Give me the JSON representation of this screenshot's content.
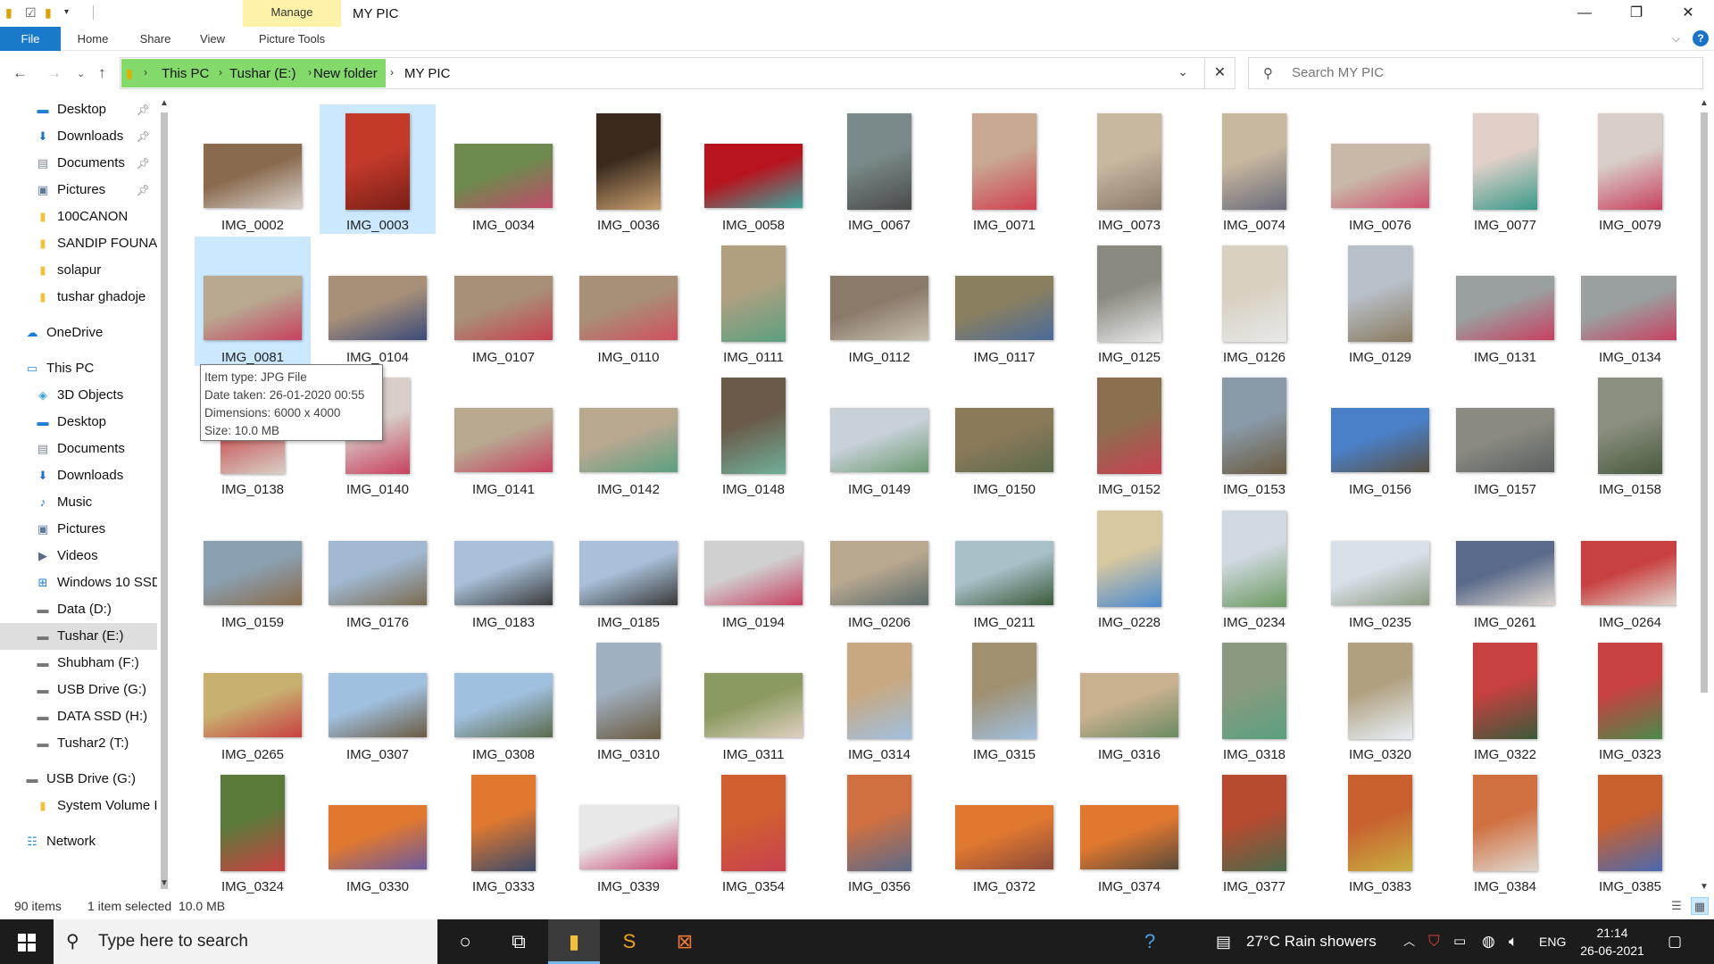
{
  "window": {
    "title": "MY PIC",
    "manage_tab": "Manage",
    "picture_tools_tab": "Picture Tools",
    "minimize": "—",
    "restore": "❐",
    "close": "✕"
  },
  "ribbon": {
    "tabs": [
      "File",
      "Home",
      "Share",
      "View"
    ]
  },
  "address": {
    "crumbs": [
      "This PC",
      "Tushar (E:)",
      "New folder",
      "MY PIC"
    ],
    "search_placeholder": "Search MY PIC"
  },
  "navpane": {
    "items": [
      {
        "label": "Desktop",
        "icon": "desktop-icon",
        "glyph": "▬",
        "color": "#1e7fd6",
        "pinned": true,
        "indent": 1
      },
      {
        "label": "Downloads",
        "icon": "download-icon",
        "glyph": "⬇",
        "color": "#1e6fc6",
        "pinned": true,
        "indent": 1
      },
      {
        "label": "Documents",
        "icon": "documents-icon",
        "glyph": "▤",
        "color": "#7a8a9a",
        "pinned": true,
        "indent": 1
      },
      {
        "label": "Pictures",
        "icon": "pictures-icon",
        "glyph": "▣",
        "color": "#5a7a9a",
        "pinned": true,
        "indent": 1
      },
      {
        "label": "100CANON",
        "icon": "folder-icon",
        "glyph": "▮",
        "color": "#f2c13c",
        "pinned": false,
        "indent": 1
      },
      {
        "label": "SANDIP FOUNAI",
        "icon": "folder-icon",
        "glyph": "▮",
        "color": "#f2c13c",
        "pinned": false,
        "indent": 1
      },
      {
        "label": "solapur",
        "icon": "folder-icon",
        "glyph": "▮",
        "color": "#f2c13c",
        "pinned": false,
        "indent": 1
      },
      {
        "label": "tushar ghadoje",
        "icon": "folder-icon",
        "glyph": "▮",
        "color": "#f2c13c",
        "pinned": false,
        "indent": 1
      },
      {
        "label": "OneDrive",
        "icon": "cloud-icon",
        "glyph": "☁",
        "color": "#1a7bd3",
        "pinned": false,
        "indent": 0,
        "gap": true
      },
      {
        "label": "This PC",
        "icon": "computer-icon",
        "glyph": "▭",
        "color": "#2a8ad8",
        "pinned": false,
        "indent": 0,
        "gap": true
      },
      {
        "label": "3D Objects",
        "icon": "cube-icon",
        "glyph": "◈",
        "color": "#3aa0e0",
        "pinned": false,
        "indent": 1
      },
      {
        "label": "Desktop",
        "icon": "desktop-icon",
        "glyph": "▬",
        "color": "#1e7fd6",
        "pinned": false,
        "indent": 1
      },
      {
        "label": "Documents",
        "icon": "documents-icon",
        "glyph": "▤",
        "color": "#7a8a9a",
        "pinned": false,
        "indent": 1
      },
      {
        "label": "Downloads",
        "icon": "download-icon",
        "glyph": "⬇",
        "color": "#1e6fc6",
        "pinned": false,
        "indent": 1
      },
      {
        "label": "Music",
        "icon": "music-icon",
        "glyph": "♪",
        "color": "#1e6fc6",
        "pinned": false,
        "indent": 1
      },
      {
        "label": "Pictures",
        "icon": "pictures-icon",
        "glyph": "▣",
        "color": "#5a7a9a",
        "pinned": false,
        "indent": 1
      },
      {
        "label": "Videos",
        "icon": "video-icon",
        "glyph": "▶",
        "color": "#5a6a8a",
        "pinned": false,
        "indent": 1
      },
      {
        "label": "Windows 10 SSD",
        "icon": "windows-drive-icon",
        "glyph": "⊞",
        "color": "#1e7fd6",
        "pinned": false,
        "indent": 1
      },
      {
        "label": "Data (D:)",
        "icon": "drive-icon",
        "glyph": "▬",
        "color": "#777",
        "pinned": false,
        "indent": 1
      },
      {
        "label": "Tushar (E:)",
        "icon": "drive-icon",
        "glyph": "▬",
        "color": "#777",
        "pinned": false,
        "indent": 1,
        "selected": true
      },
      {
        "label": "Shubham (F:)",
        "icon": "drive-icon",
        "glyph": "▬",
        "color": "#777",
        "pinned": false,
        "indent": 1
      },
      {
        "label": "USB Drive (G:)",
        "icon": "drive-icon",
        "glyph": "▬",
        "color": "#777",
        "pinned": false,
        "indent": 1
      },
      {
        "label": "DATA SSD (H:)",
        "icon": "drive-icon",
        "glyph": "▬",
        "color": "#777",
        "pinned": false,
        "indent": 1
      },
      {
        "label": "Tushar2 (T:)",
        "icon": "drive-icon",
        "glyph": "▬",
        "color": "#777",
        "pinned": false,
        "indent": 1
      },
      {
        "label": "USB Drive (G:)",
        "icon": "usb-drive-icon",
        "glyph": "▬",
        "color": "#777",
        "pinned": false,
        "indent": 0,
        "gap": true
      },
      {
        "label": "System Volume I",
        "icon": "folder-icon",
        "glyph": "▮",
        "color": "#f2c13c",
        "pinned": false,
        "indent": 1
      },
      {
        "label": "Network",
        "icon": "network-icon",
        "glyph": "☷",
        "color": "#2a8ad8",
        "pinned": false,
        "indent": 0,
        "gap": true
      }
    ]
  },
  "files": [
    {
      "name": "IMG_0002",
      "orient": "land",
      "c1": "#8a6a4e",
      "c2": "#d8d2cc"
    },
    {
      "name": "IMG_0003",
      "orient": "port",
      "c1": "#c33a2a",
      "c2": "#7a1f18",
      "selected": true
    },
    {
      "name": "IMG_0034",
      "orient": "land",
      "c1": "#6e8a4e",
      "c2": "#c24a6a"
    },
    {
      "name": "IMG_0036",
      "orient": "port",
      "c1": "#3a2a1e",
      "c2": "#c8a070"
    },
    {
      "name": "IMG_0058",
      "orient": "land",
      "c1": "#b8141e",
      "c2": "#3aa8a0"
    },
    {
      "name": "IMG_0067",
      "orient": "port",
      "c1": "#7a8a8a",
      "c2": "#4a4a4a"
    },
    {
      "name": "IMG_0071",
      "orient": "port",
      "c1": "#c8a890",
      "c2": "#d04050"
    },
    {
      "name": "IMG_0073",
      "orient": "port",
      "c1": "#c8b8a0",
      "c2": "#8a7a6a"
    },
    {
      "name": "IMG_0074",
      "orient": "port",
      "c1": "#c8b8a0",
      "c2": "#6a6a7a"
    },
    {
      "name": "IMG_0076",
      "orient": "land",
      "c1": "#c8b8a8",
      "c2": "#d05070"
    },
    {
      "name": "IMG_0077",
      "orient": "port",
      "c1": "#e0d0c8",
      "c2": "#3a9a8a"
    },
    {
      "name": "IMG_0079",
      "orient": "port",
      "c1": "#d8d0c8",
      "c2": "#c84060"
    },
    {
      "name": "IMG_0081",
      "orient": "land",
      "c1": "#b8a890",
      "c2": "#c84060",
      "selected": true
    },
    {
      "name": "IMG_0104",
      "orient": "land",
      "c1": "#a89078",
      "c2": "#3a4a7a"
    },
    {
      "name": "IMG_0107",
      "orient": "land",
      "c1": "#a89078",
      "c2": "#c84050"
    },
    {
      "name": "IMG_0110",
      "orient": "land",
      "c1": "#a89078",
      "c2": "#d05060"
    },
    {
      "name": "IMG_0111",
      "orient": "port",
      "c1": "#b0a080",
      "c2": "#5aa080"
    },
    {
      "name": "IMG_0112",
      "orient": "land",
      "c1": "#8a7a6a",
      "c2": "#c8c0b0"
    },
    {
      "name": "IMG_0117",
      "orient": "land",
      "c1": "#8a8060",
      "c2": "#4a6a9a"
    },
    {
      "name": "IMG_0125",
      "orient": "port",
      "c1": "#8a8a80",
      "c2": "#e8e8e8"
    },
    {
      "name": "IMG_0126",
      "orient": "port",
      "c1": "#d8d0c0",
      "c2": "#e8e8e8"
    },
    {
      "name": "IMG_0129",
      "orient": "port",
      "c1": "#b8c0c8",
      "c2": "#8a7a60"
    },
    {
      "name": "IMG_0131",
      "orient": "land",
      "c1": "#9aa0a0",
      "c2": "#c84060"
    },
    {
      "name": "IMG_0134",
      "orient": "land",
      "c1": "#9aa0a0",
      "c2": "#c84060"
    },
    {
      "name": "IMG_0138",
      "orient": "port",
      "c1": "#c85050",
      "c2": "#d8d0c8"
    },
    {
      "name": "IMG_0140",
      "orient": "port",
      "c1": "#d8d0c8",
      "c2": "#c84060"
    },
    {
      "name": "IMG_0141",
      "orient": "land",
      "c1": "#b8a890",
      "c2": "#c84060"
    },
    {
      "name": "IMG_0142",
      "orient": "land",
      "c1": "#b8a890",
      "c2": "#5aa080"
    },
    {
      "name": "IMG_0148",
      "orient": "port",
      "c1": "#6a5a4a",
      "c2": "#70b098"
    },
    {
      "name": "IMG_0149",
      "orient": "land",
      "c1": "#c8d0d8",
      "c2": "#6a9a70"
    },
    {
      "name": "IMG_0150",
      "orient": "land",
      "c1": "#8a7a5a",
      "c2": "#5a6a4a"
    },
    {
      "name": "IMG_0152",
      "orient": "port",
      "c1": "#8a7050",
      "c2": "#c84050"
    },
    {
      "name": "IMG_0153",
      "orient": "port",
      "c1": "#8a9aa8",
      "c2": "#6a5a40"
    },
    {
      "name": "IMG_0156",
      "orient": "land",
      "c1": "#4a80c8",
      "c2": "#5a5040"
    },
    {
      "name": "IMG_0157",
      "orient": "land",
      "c1": "#8a8a80",
      "c2": "#5a6060"
    },
    {
      "name": "IMG_0158",
      "orient": "port",
      "c1": "#8a9080",
      "c2": "#4a5a40"
    },
    {
      "name": "IMG_0159",
      "orient": "land",
      "c1": "#8aa0b0",
      "c2": "#8a6a4a"
    },
    {
      "name": "IMG_0176",
      "orient": "land",
      "c1": "#a0b8d0",
      "c2": "#7a6a50"
    },
    {
      "name": "IMG_0183",
      "orient": "land",
      "c1": "#a8c0d8",
      "c2": "#3a3a3a"
    },
    {
      "name": "IMG_0185",
      "orient": "land",
      "c1": "#a8c0d8",
      "c2": "#3a3a3a"
    },
    {
      "name": "IMG_0194",
      "orient": "land",
      "c1": "#d0d0d0",
      "c2": "#c84060"
    },
    {
      "name": "IMG_0206",
      "orient": "land",
      "c1": "#b8a890",
      "c2": "#5a6a6a"
    },
    {
      "name": "IMG_0211",
      "orient": "land",
      "c1": "#a8c0c8",
      "c2": "#3a5a3a"
    },
    {
      "name": "IMG_0228",
      "orient": "port",
      "c1": "#d8c8a0",
      "c2": "#4a8ad0"
    },
    {
      "name": "IMG_0234",
      "orient": "port",
      "c1": "#d0d8e0",
      "c2": "#6a9a60"
    },
    {
      "name": "IMG_0235",
      "orient": "land",
      "c1": "#d8e0e8",
      "c2": "#8a9a80"
    },
    {
      "name": "IMG_0261",
      "orient": "land",
      "c1": "#5a6a8a",
      "c2": "#e0d8d0"
    },
    {
      "name": "IMG_0264",
      "orient": "land",
      "c1": "#c84040",
      "c2": "#e0d8d0"
    },
    {
      "name": "IMG_0265",
      "orient": "land",
      "c1": "#c8b070",
      "c2": "#c84040"
    },
    {
      "name": "IMG_0307",
      "orient": "land",
      "c1": "#a0c0e0",
      "c2": "#6a5a40"
    },
    {
      "name": "IMG_0308",
      "orient": "land",
      "c1": "#a0c0e0",
      "c2": "#5a6a4a"
    },
    {
      "name": "IMG_0310",
      "orient": "port",
      "c1": "#a0b0c0",
      "c2": "#6a5a40"
    },
    {
      "name": "IMG_0311",
      "orient": "land",
      "c1": "#8a9a60",
      "c2": "#e0d0c0"
    },
    {
      "name": "IMG_0314",
      "orient": "port",
      "c1": "#c8a880",
      "c2": "#a0c0e0"
    },
    {
      "name": "IMG_0315",
      "orient": "port",
      "c1": "#a09070",
      "c2": "#a0c0e0"
    },
    {
      "name": "IMG_0316",
      "orient": "land",
      "c1": "#c8b090",
      "c2": "#6a8a60"
    },
    {
      "name": "IMG_0318",
      "orient": "port",
      "c1": "#8a9a80",
      "c2": "#5aa080"
    },
    {
      "name": "IMG_0320",
      "orient": "port",
      "c1": "#b0a080",
      "c2": "#e8f0f8"
    },
    {
      "name": "IMG_0322",
      "orient": "port",
      "c1": "#c84040",
      "c2": "#3a5a3a"
    },
    {
      "name": "IMG_0323",
      "orient": "port",
      "c1": "#c84040",
      "c2": "#4a8a4a"
    },
    {
      "name": "IMG_0324",
      "orient": "port",
      "c1": "#5a7a3a",
      "c2": "#c84040"
    },
    {
      "name": "IMG_0330",
      "orient": "land",
      "c1": "#e07830",
      "c2": "#6a5aa0"
    },
    {
      "name": "IMG_0333",
      "orient": "port",
      "c1": "#e07830",
      "c2": "#3a4a6a"
    },
    {
      "name": "IMG_0339",
      "orient": "land",
      "c1": "#e8e8e8",
      "c2": "#c84070"
    },
    {
      "name": "IMG_0354",
      "orient": "port",
      "c1": "#d06030",
      "c2": "#c84050"
    },
    {
      "name": "IMG_0356",
      "orient": "port",
      "c1": "#d07040",
      "c2": "#5a6a8a"
    },
    {
      "name": "IMG_0372",
      "orient": "land",
      "c1": "#e07830",
      "c2": "#8a4a3a"
    },
    {
      "name": "IMG_0374",
      "orient": "land",
      "c1": "#e07830",
      "c2": "#5a4a3a"
    },
    {
      "name": "IMG_0377",
      "orient": "port",
      "c1": "#b84a30",
      "c2": "#4a6a4a"
    },
    {
      "name": "IMG_0383",
      "orient": "port",
      "c1": "#c86030",
      "c2": "#c8b040"
    },
    {
      "name": "IMG_0384",
      "orient": "port",
      "c1": "#d07040",
      "c2": "#e0d8d0"
    },
    {
      "name": "IMG_0385",
      "orient": "port",
      "c1": "#c86030",
      "c2": "#4a6ab0"
    }
  ],
  "tooltip": {
    "type": "Item type: JPG File",
    "date": "Date taken: 26-01-2020 00:55",
    "dims": "Dimensions: 6000 x 4000",
    "size": "Size: 10.0 MB"
  },
  "status": {
    "count": "90 items",
    "selection": "1 item selected  10.0 MB"
  },
  "taskbar": {
    "search_placeholder": "Type here to search",
    "weather": "27°C  Rain showers",
    "language": "ENG",
    "time": "21:14",
    "date": "26-06-2021"
  }
}
